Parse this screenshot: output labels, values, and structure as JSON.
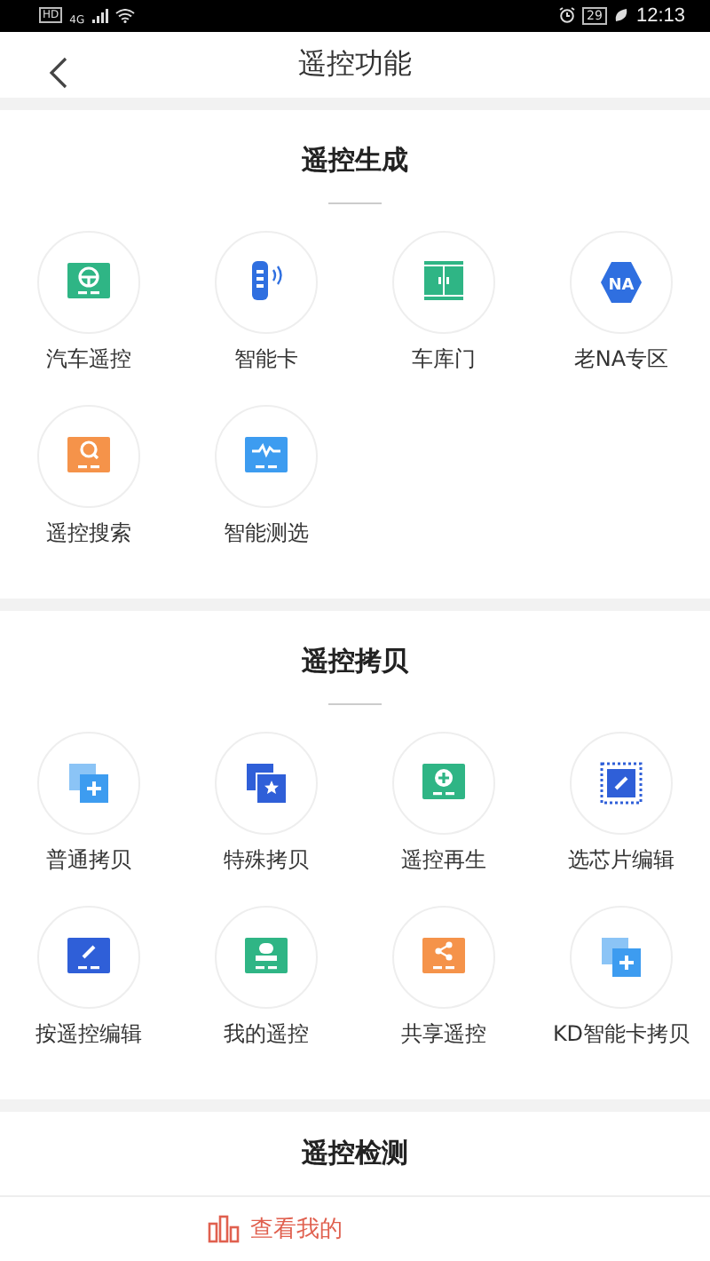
{
  "status_bar": {
    "hd": "HD",
    "network": "4G",
    "battery": "29",
    "time": "12:13"
  },
  "header": {
    "title": "遥控功能"
  },
  "sections": [
    {
      "title": "遥控生成",
      "items": [
        {
          "label": "汽车遥控",
          "kind": "wheel",
          "color": "#2fb585"
        },
        {
          "label": "智能卡",
          "kind": "fob",
          "color": "#2f6fe0"
        },
        {
          "label": "车库门",
          "kind": "garage",
          "color": "#2fb585"
        },
        {
          "label": "老NA专区",
          "kind": "hexagon",
          "color": "#2f6fe0",
          "badge": "NA"
        },
        {
          "label": "遥控搜索",
          "kind": "search",
          "color": "#f5934a"
        },
        {
          "label": "智能测选",
          "kind": "wave",
          "color": "#3d9cf0"
        }
      ]
    },
    {
      "title": "遥控拷贝",
      "items": [
        {
          "label": "普通拷贝",
          "kind": "copy-plus",
          "color": "#3d9cf0"
        },
        {
          "label": "特殊拷贝",
          "kind": "copy-star",
          "color": "#2f5fd8"
        },
        {
          "label": "遥控再生",
          "kind": "plus-panel",
          "color": "#2fb585"
        },
        {
          "label": "选芯片编辑",
          "kind": "chip",
          "color": "#2f5fd8"
        },
        {
          "label": "按遥控编辑",
          "kind": "pencil",
          "color": "#2f5fd8"
        },
        {
          "label": "我的遥控",
          "kind": "person",
          "color": "#2fb585"
        },
        {
          "label": "共享遥控",
          "kind": "share",
          "color": "#f5934a"
        },
        {
          "label": "KD智能卡拷贝",
          "kind": "copy-plus",
          "color": "#3d9cf0"
        }
      ]
    },
    {
      "title": "遥控检测"
    }
  ],
  "bottom_bar": {
    "text": "查看我的"
  }
}
